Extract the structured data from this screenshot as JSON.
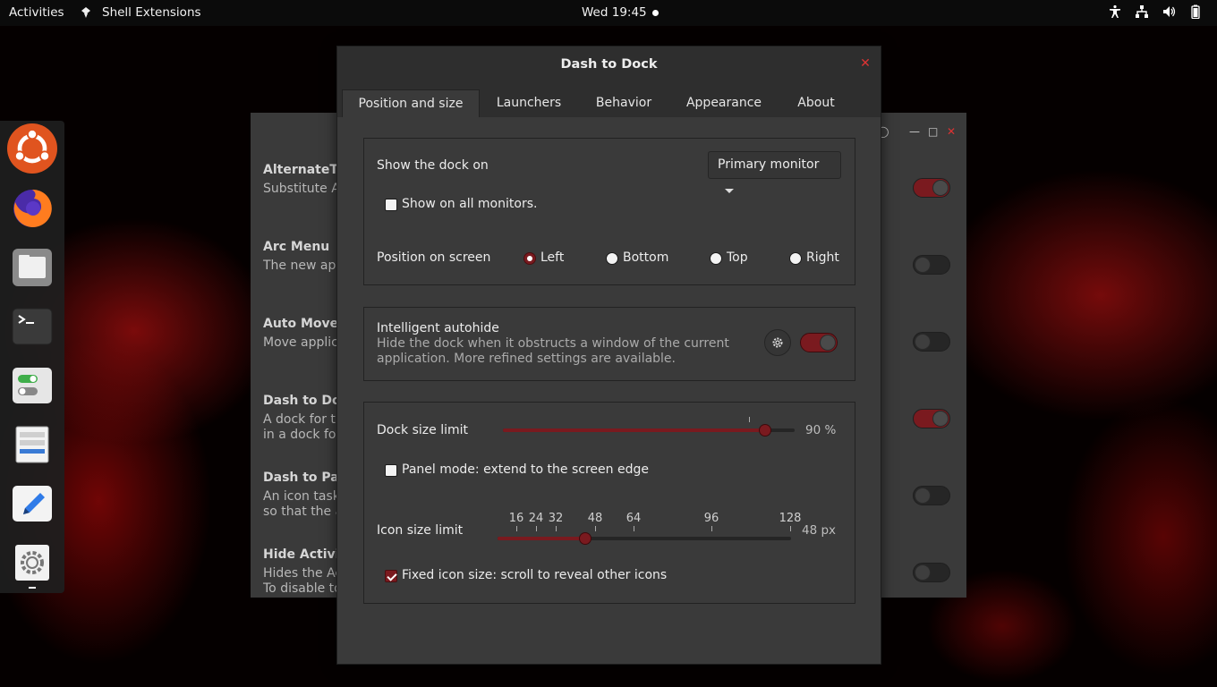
{
  "topbar": {
    "activities": "Activities",
    "app_name": "Shell Extensions",
    "clock": "Wed 19:45",
    "tray_icons": [
      "accessibility-icon",
      "network-icon",
      "volume-icon",
      "battery-icon"
    ]
  },
  "dock": {
    "items": [
      "ubuntu-logo-icon",
      "firefox-icon",
      "files-icon",
      "terminal-icon",
      "extensions-app-icon",
      "software-properties-icon",
      "text-editor-icon",
      "settings-icon"
    ]
  },
  "extensions_window": {
    "rows": [
      {
        "title": "AlternateTa",
        "desc": "Substitute A",
        "enabled": true
      },
      {
        "title": "Arc Menu",
        "desc": "The new app",
        "enabled": false
      },
      {
        "title": "Auto Move",
        "desc": "Move applic",
        "enabled": false
      },
      {
        "title": "Dash to Doc",
        "desc": "A dock for th",
        "desc2": "in a dock for",
        "enabled": true
      },
      {
        "title": "Dash to Par",
        "desc": "An icon task",
        "desc2": "so that the a",
        "enabled": false
      },
      {
        "title": "Hide Activit",
        "desc": "Hides the Ac",
        "desc2": "To disable to",
        "enabled": false
      }
    ]
  },
  "dialog": {
    "title": "Dash to Dock",
    "tabs": [
      "Position and size",
      "Launchers",
      "Behavior",
      "Appearance",
      "About"
    ],
    "active_tab": "Position and size",
    "show_dock_on_label": "Show the dock on",
    "show_dock_on_value": "Primary monitor",
    "show_all_monitors_label": "Show on all monitors.",
    "show_all_monitors_checked": false,
    "position_label": "Position on screen",
    "positions": [
      {
        "label": "Left",
        "checked": true
      },
      {
        "label": "Bottom",
        "checked": false
      },
      {
        "label": "Top",
        "checked": false
      },
      {
        "label": "Right",
        "checked": false
      }
    ],
    "autohide_title": "Intelligent autohide",
    "autohide_desc_line1": "Hide the dock when it obstructs a window of the current",
    "autohide_desc_line2": "application. More refined settings are available.",
    "autohide_enabled": true,
    "dock_size_label": "Dock size limit",
    "dock_size_fraction": 0.9,
    "dock_size_value": "90 %",
    "panel_mode_label": "Panel mode: extend to the screen edge",
    "panel_mode_checked": false,
    "icon_size_label": "Icon size limit",
    "icon_size_marks": [
      "16",
      "24",
      "32",
      "48",
      "64",
      "96",
      "128"
    ],
    "icon_size_value": "48 px",
    "icon_size_fraction": 0.3,
    "fixed_icon_label": "Fixed icon size: scroll to reveal other icons",
    "fixed_icon_checked": true
  },
  "colors": {
    "accent": "#7a1a1f",
    "close": "#dd3333",
    "dialog_bg": "#3a3a3a",
    "topbar_bg": "#0b0b0b"
  }
}
